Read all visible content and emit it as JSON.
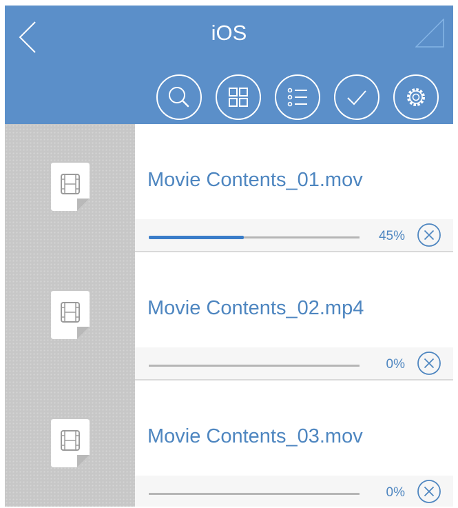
{
  "header": {
    "title": "iOS",
    "background_color": "#5b8fc9",
    "back_icon": "chevron-left-icon",
    "corner_icon": "triangle-outline-icon"
  },
  "toolbar": {
    "buttons": [
      {
        "name": "search-button",
        "icon": "search-icon"
      },
      {
        "name": "grid-view-button",
        "icon": "grid-icon"
      },
      {
        "name": "list-view-button",
        "icon": "list-icon"
      },
      {
        "name": "select-button",
        "icon": "checkmark-icon"
      },
      {
        "name": "settings-button",
        "icon": "gear-icon"
      }
    ]
  },
  "downloads": {
    "accent_color": "#3a7dc9",
    "text_color": "#4e86c0",
    "items": [
      {
        "filename": "Movie Contents_01.mov",
        "progress": 0.45,
        "percent_label": "45%",
        "icon": "video-file-icon",
        "cancel_icon": "close-circle-icon"
      },
      {
        "filename": "Movie Contents_02.mp4",
        "progress": 0,
        "percent_label": "0%",
        "icon": "video-file-icon",
        "cancel_icon": "close-circle-icon"
      },
      {
        "filename": "Movie Contents_03.mov",
        "progress": 0,
        "percent_label": "0%",
        "icon": "video-file-icon",
        "cancel_icon": "close-circle-icon"
      }
    ]
  }
}
